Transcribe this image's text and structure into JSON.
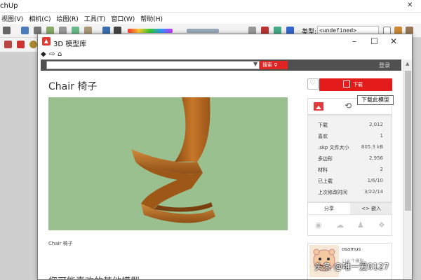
{
  "app": {
    "title_fragment": "chUp",
    "menu": [
      "视图(V)",
      "相机(C)",
      "绘图(R)",
      "工具(T)",
      "窗口(W)",
      "帮助(H)"
    ],
    "type_label": "类型:",
    "type_value": "<undefined>"
  },
  "window": {
    "title": "3D 模型库",
    "minimize": "–",
    "maximize": "☐",
    "close": "✕",
    "back": "◆",
    "forward": "⇨",
    "home": "⌂"
  },
  "search": {
    "placeholder": "",
    "button_label": "搜索",
    "login": "登录"
  },
  "model": {
    "title": "Chair 椅子",
    "caption": "Chair 椅子",
    "more_heading": "您可能喜欢的其他模型"
  },
  "actions": {
    "download_label": "下载",
    "download_tooltip": "下载此模型"
  },
  "stats": [
    {
      "label": "下载",
      "value": "2,012"
    },
    {
      "label": "喜欢",
      "value": "1"
    },
    {
      "label": ".skp 文件大小",
      "value": "805.3 kB"
    },
    {
      "label": "多边形",
      "value": "2,956"
    },
    {
      "label": "材料",
      "value": "2"
    },
    {
      "label": "已上载",
      "value": "1/6/10"
    },
    {
      "label": "上次修改时间",
      "value": "3/22/14"
    }
  ],
  "share": {
    "share_tab": "分享",
    "embed_tab": "<> 嵌入"
  },
  "author": {
    "name": "osamus",
    "models": "118 个模型"
  },
  "watermark": "头条 @唯一爱0127",
  "colors": {
    "accent_red": "#e41b1b",
    "preview_bg": "#9bc08f",
    "chair_wood": "#b5651d"
  }
}
